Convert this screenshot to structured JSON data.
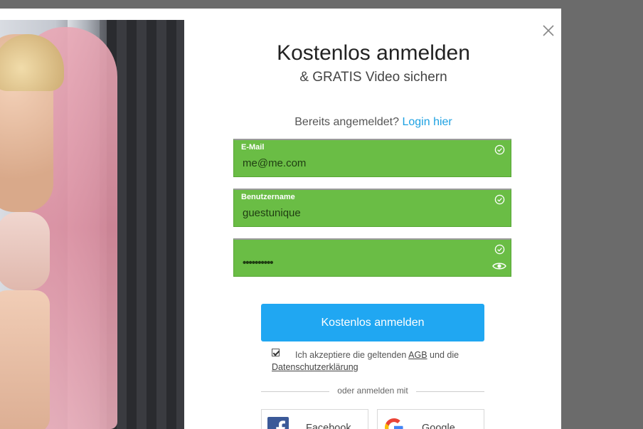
{
  "modal": {
    "title": "Kostenlos anmelden",
    "subtitle": "& GRATIS Video sichern",
    "login_prompt": "Bereits angemeldet?",
    "login_link": "Login hier"
  },
  "form": {
    "email": {
      "label": "E-Mail",
      "value": "me@me.com"
    },
    "username": {
      "label": "Benutzername",
      "value": "guestunique"
    },
    "password": {
      "value": "••••••••••"
    },
    "valid_color": "#6abd45"
  },
  "submit": {
    "label": "Kostenlos anmelden",
    "color": "#20a7f2"
  },
  "terms": {
    "checked": true,
    "text_before": "Ich akzeptiere die geltenden ",
    "agb": "AGB",
    "text_middle": " und die",
    "privacy": "Datenschutzerklärung"
  },
  "social": {
    "divider": "oder anmelden mit",
    "facebook": {
      "label": "Facebook",
      "icon": "facebook-icon"
    },
    "google": {
      "label": "Google",
      "icon": "google-icon"
    }
  }
}
